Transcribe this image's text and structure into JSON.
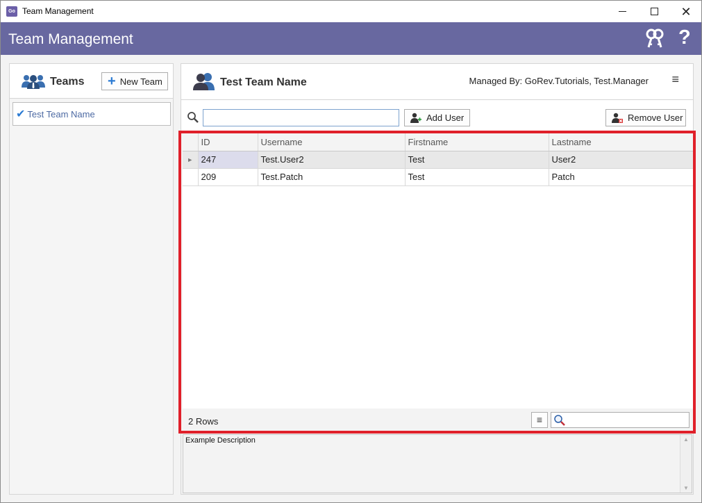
{
  "window": {
    "title": "Team Management",
    "app_icon_text": "GoRev"
  },
  "header": {
    "title": "Team Management",
    "help_symbol": "?",
    "icons": [
      "keys-icon",
      "help-icon"
    ]
  },
  "teams_panel": {
    "title": "Teams",
    "new_team_label": "New Team",
    "items": [
      {
        "label": "Test Team Name",
        "selected": true
      }
    ]
  },
  "team_detail": {
    "name": "Test Team Name",
    "managed_by": "Managed By: GoRev.Tutorials, Test.Manager",
    "search_value": "",
    "add_user_label": "Add User",
    "remove_user_label": "Remove User"
  },
  "grid": {
    "columns": [
      "ID",
      "Username",
      "Firstname",
      "Lastname"
    ],
    "rows": [
      {
        "id": "247",
        "username": "Test.User2",
        "firstname": "Test",
        "lastname": "User2"
      },
      {
        "id": "209",
        "username": "Test.Patch",
        "firstname": "Test",
        "lastname": "Patch"
      }
    ],
    "row_count_label": "2 Rows",
    "footer_search_value": ""
  },
  "description": "Example Description",
  "colors": {
    "header_band": "#6868a0",
    "accent_blue": "#2b7bd3",
    "highlight_red": "#e0202a"
  }
}
